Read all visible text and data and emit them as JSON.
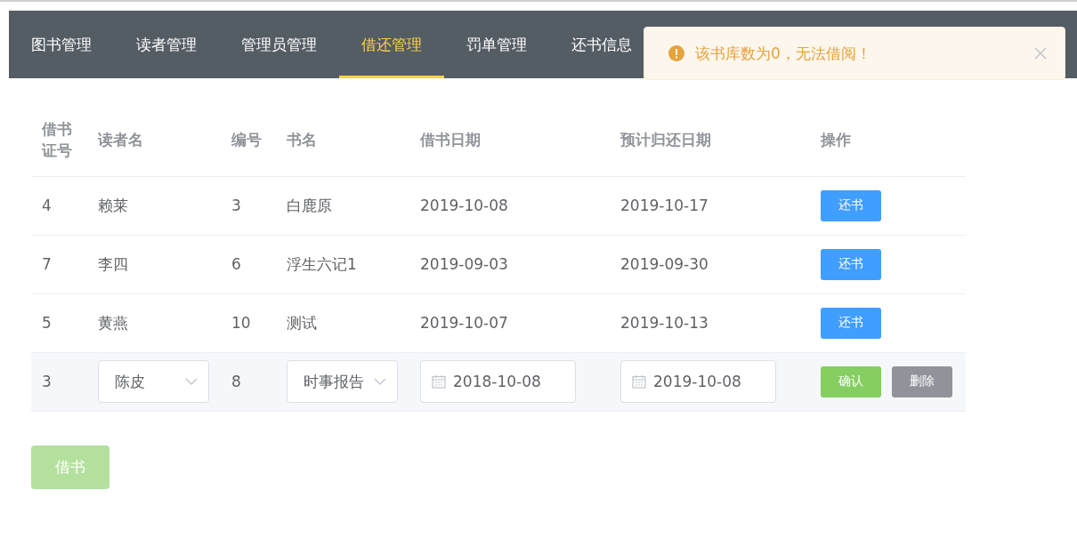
{
  "nav": {
    "tabs": [
      {
        "label": "图书管理",
        "selected": false
      },
      {
        "label": "读者管理",
        "selected": false
      },
      {
        "label": "管理员管理",
        "selected": false
      },
      {
        "label": "借还管理",
        "selected": true
      },
      {
        "label": "罚单管理",
        "selected": false
      },
      {
        "label": "还书信息",
        "selected": false
      }
    ]
  },
  "toast": {
    "message": "该书库数为0，无法借阅！"
  },
  "table": {
    "columns": [
      "借书证号",
      "读者名",
      "编号",
      "书名",
      "借书日期",
      "预计归还日期",
      "操作"
    ],
    "rows": [
      {
        "kind": "view",
        "card_no": "4",
        "reader": "赖莱",
        "book_no": "3",
        "title": "白鹿原",
        "borrow_date": "2019-10-08",
        "due_date": "2019-10-17",
        "actions": [
          "还书"
        ]
      },
      {
        "kind": "view",
        "card_no": "7",
        "reader": "李四",
        "book_no": "6",
        "title": "浮生六记1",
        "borrow_date": "2019-09-03",
        "due_date": "2019-09-30",
        "actions": [
          "还书"
        ]
      },
      {
        "kind": "view",
        "card_no": "5",
        "reader": "黄燕",
        "book_no": "10",
        "title": "测试",
        "borrow_date": "2019-10-07",
        "due_date": "2019-10-13",
        "actions": [
          "还书"
        ]
      },
      {
        "kind": "edit",
        "card_no": "3",
        "reader": "陈皮",
        "book_no": "8",
        "title": "时事报告",
        "borrow_date": "2018-10-08",
        "due_date": "2019-10-08",
        "actions": [
          "确认",
          "删除"
        ]
      }
    ]
  },
  "borrow_button": {
    "label": "借书",
    "disabled": true
  }
}
